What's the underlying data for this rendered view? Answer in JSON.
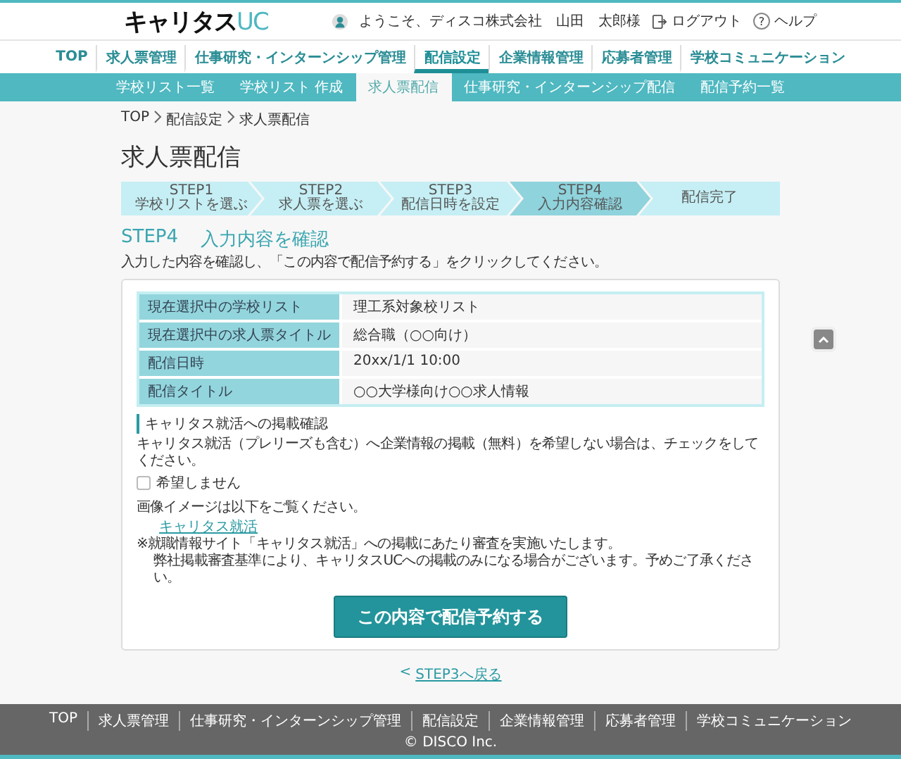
{
  "header": {
    "logo": {
      "main": "キャリタス",
      "accent": "UC"
    },
    "user": "ようこそ、ディスコ株式会社　山田　太郎様",
    "logout": "ログアウト",
    "help_icon": "?",
    "help": "ヘルプ"
  },
  "main_nav": [
    {
      "label": "TOP",
      "selected": false
    },
    {
      "label": "求人票管理",
      "selected": false
    },
    {
      "label": "仕事研究・インターンシップ管理",
      "selected": false
    },
    {
      "label": "配信設定",
      "selected": true
    },
    {
      "label": "企業情報管理",
      "selected": false
    },
    {
      "label": "応募者管理",
      "selected": false
    },
    {
      "label": "学校コミュニケーション",
      "selected": false
    }
  ],
  "sub_nav": [
    {
      "label": "学校リスト一覧",
      "selected": false
    },
    {
      "label": "学校リスト 作成",
      "selected": false
    },
    {
      "label": "求人票配信",
      "selected": true
    },
    {
      "label": "仕事研究・インターンシップ配信",
      "selected": false
    },
    {
      "label": "配信予約一覧",
      "selected": false
    }
  ],
  "breadcrumb": [
    "TOP",
    "配信設定",
    "求人票配信"
  ],
  "page_title": "求人票配信",
  "steps": [
    {
      "step": "STEP1",
      "label": "学校リストを選ぶ",
      "selected": false
    },
    {
      "step": "STEP2",
      "label": "求人票を選ぶ",
      "selected": false
    },
    {
      "step": "STEP3",
      "label": "配信日時を設定",
      "selected": false
    },
    {
      "step": "STEP4",
      "label": "入力内容確認",
      "selected": true
    },
    {
      "label": "配信完了",
      "selected": false
    }
  ],
  "section": {
    "step": "STEP4",
    "title": "入力内容を確認",
    "description": "入力した内容を確認し、「この内容で配信予約する」をクリックしてください。"
  },
  "summary": [
    {
      "label": "現在選択中の学校リスト",
      "value": "理工系対象校リスト"
    },
    {
      "label": "現在選択中の求人票タイトル",
      "value": "総合職（○○向け）"
    },
    {
      "label": "配信日時",
      "value": "20xx/1/1 10:00"
    },
    {
      "label": "配信タイトル",
      "value": "○○大学様向け○○求人情報"
    }
  ],
  "posting": {
    "heading": "キャリタス就活への掲載確認",
    "text": "キャリタス就活（プレリーズも含む）へ企業情報の掲載（無料）を希望しない場合は、チェックをしてください。",
    "checkbox": {
      "label": "希望しません",
      "checked": false
    },
    "image_note": "画像イメージは以下をご覧ください。",
    "link": "キャリタス就活",
    "notes": [
      "※就職情報サイト「キャリタス就活」への掲載にあたり審査を実施いたします。",
      "弊社掲載審査基準により、キャリタスUCへの掲載のみになる場合がございます。予めご了承ください。"
    ]
  },
  "submit": "この内容で配信予約する",
  "back_link": {
    "arrow": "<",
    "label": "STEP3へ戻る"
  },
  "footer": {
    "links": [
      "TOP",
      "求人票管理",
      "仕事研究・インターンシップ管理",
      "配信設定",
      "企業情報管理",
      "応募者管理",
      "学校コミュニケーション"
    ],
    "copyright": "© DISCO Inc."
  }
}
